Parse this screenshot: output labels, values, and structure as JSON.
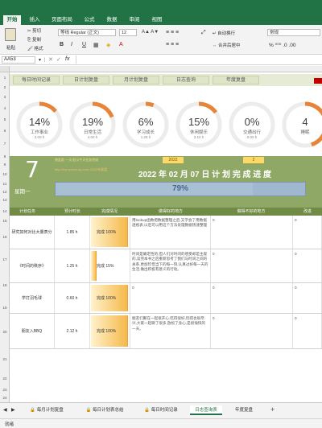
{
  "ribbon_tabs": [
    "开始",
    "插入",
    "页面布局",
    "公式",
    "数据",
    "审阅",
    "视图"
  ],
  "clipboard": {
    "paste": "粘贴",
    "cut": "剪切",
    "copy": "复制",
    "format_painter": "格式"
  },
  "font": {
    "name": "等线 Regular (正文)",
    "size": "12"
  },
  "font_buttons": [
    "B",
    "I",
    "U"
  ],
  "align": {
    "wrap": "自动换行",
    "merge": "合并后居中"
  },
  "number_format": "常规",
  "namebox": "AA53",
  "fx": "fx",
  "row_numbers": [
    "1",
    "2",
    "3",
    "4",
    "5",
    "6",
    "7",
    "8",
    "9",
    "10",
    "11",
    "12",
    "13",
    "14",
    "15",
    "16",
    "17",
    "18",
    "19",
    "20",
    "21",
    "22",
    "23",
    "24",
    "25",
    "26",
    "27",
    "28",
    "29"
  ],
  "nav_buttons": [
    "每日时间记录",
    "日计划复盘",
    "月计划复盘",
    "日志查询",
    "年度复盘"
  ],
  "gauges": [
    {
      "pct": "14%",
      "label": "工作事业",
      "sub": "3.00 h",
      "value": 0.14,
      "color": "#e8843a"
    },
    {
      "pct": "19%",
      "label": "日常生活",
      "sub": "4.00 h",
      "value": 0.19,
      "color": "#e8843a"
    },
    {
      "pct": "6%",
      "label": "学习成长",
      "sub": "1.25 h",
      "value": 0.06,
      "color": "#e8843a"
    },
    {
      "pct": "15%",
      "label": "休闲娱乐",
      "sub": "3.10 h",
      "value": 0.15,
      "color": "#e8843a"
    },
    {
      "pct": "0%",
      "label": "交通出行",
      "sub": "0.00 h",
      "value": 0.0,
      "color": "#e8843a"
    },
    {
      "pct": "4",
      "label": "睡眠",
      "sub": "",
      "value": 0.45,
      "color": "#e8843a"
    }
  ],
  "date_panel": {
    "day": "7",
    "weekday": "星期一",
    "note1": "按此前    一天/显示今天任务完成",
    "note2": "http://mp.weixin.qq.com/ 2022年复盘",
    "year": "2022",
    "month": "2",
    "title": "2022 年 02 月 07 日 计 划 完 成 进 度",
    "progress_text": "79%",
    "progress": 0.79
  },
  "table_headers": [
    "计划任务",
    "预计时长",
    "完成情况",
    "做得好的地方",
    "做得不好的地方",
    "改进"
  ],
  "tasks": [
    {
      "name": "研究如何对比大量表分",
      "hours": "1.85 h",
      "status": "完成 100%",
      "progress": 1.0,
      "good": "用lookup函数把数据整理之后,又学会了用数据透视表,以后可以用这个方法处理数据快速整理",
      "bad": "0",
      "improve": "0"
    },
    {
      "name": "《时间的秩序》",
      "hours": "1.25 h",
      "status": "完成 15%",
      "progress": 0.15,
      "good": "时间是确定性的,但人们对时间的感受却是主观的,读完本书之后重新思考了我们与时间之间的关系,更加珍惜当下的每一刻,认真过好每一天的生活,做出积极有意义的行动。",
      "bad": "0",
      "improve": "0"
    },
    {
      "name": "学打羽毛球",
      "hours": "0.60 h",
      "status": "完成 100%",
      "progress": 1.0,
      "good": "0",
      "bad": "0",
      "improve": "0"
    },
    {
      "name": "朋友入BBQ",
      "hours": "2.12 h",
      "status": "完成 100%",
      "progress": 1.0,
      "good": "朋友们聚在一起很开心,吃得很好,玩得也很尽兴,大家一起聊了很多,放松了身心,是很愉快的一天。",
      "bad": "0",
      "improve": "0"
    }
  ],
  "sheet_tabs": [
    "每月计划复盘",
    "每日计划表总结",
    "每日时间记录",
    "日志查询表",
    "年度复盘"
  ],
  "active_sheet": "日志查询表",
  "status_text": "就绪",
  "colors": {
    "excel_green": "#217346",
    "band_green": "#8fa866",
    "header_green": "#6f8b45",
    "gauge_orange": "#e8843a"
  }
}
